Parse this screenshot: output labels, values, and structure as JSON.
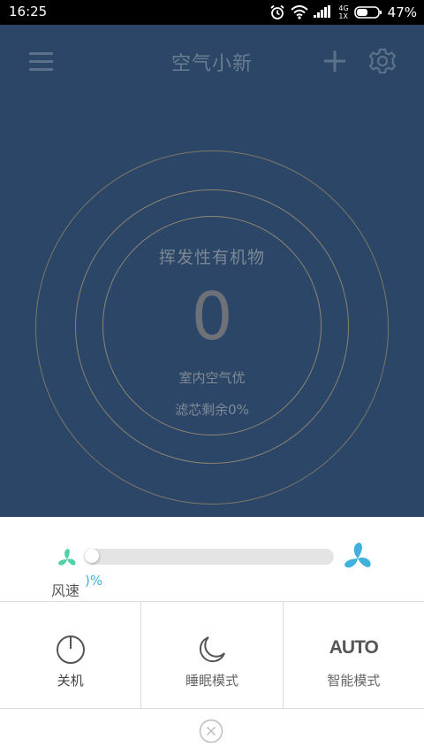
{
  "status_bar": {
    "time": "16:25",
    "network": "4G",
    "network_sub": "1X",
    "battery": "47%"
  },
  "header": {
    "title": "空气小新"
  },
  "monitor": {
    "label": "挥发性有机物",
    "value": "0",
    "air_quality": "室内空气优",
    "filter": "滤芯剩余0%"
  },
  "fan_speed": {
    "label": "风速",
    "percent_text": ")%",
    "level": 0
  },
  "controls": {
    "power_label": "关机",
    "sleep_label": "睡眠模式",
    "auto_icon_text": "AUTO",
    "auto_label": "智能模式"
  },
  "colors": {
    "hero_bg": "#2c4668",
    "fan_accent": "#3fb1dc",
    "small_fan": "#4fd0a8"
  }
}
